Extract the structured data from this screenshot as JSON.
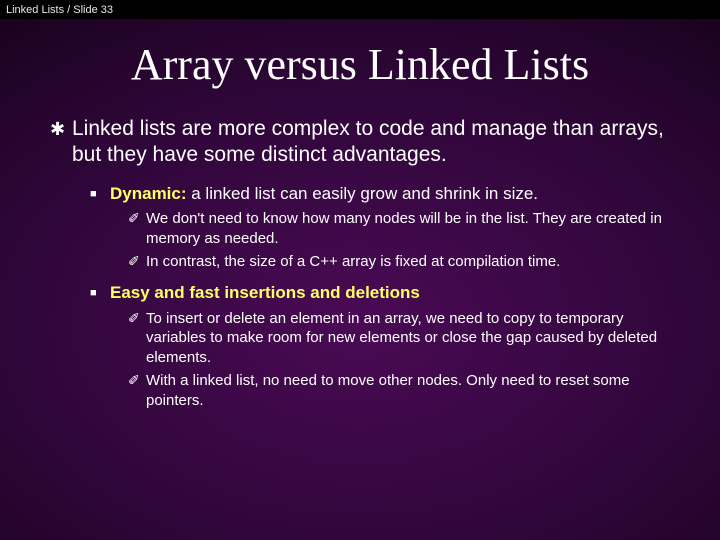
{
  "breadcrumb": "Linked Lists / Slide 33",
  "title": "Array versus Linked Lists",
  "l1": {
    "bullet": "✱",
    "text": "Linked lists are more complex to code and manage than arrays, but they have some distinct advantages."
  },
  "l2a": {
    "bullet": "■",
    "label": "Dynamic:",
    "rest": " a linked list can easily grow and shrink in size."
  },
  "l3a1": {
    "bullet": "✐",
    "text": "We don't need to know how many nodes will be in the list. They are created in memory as needed."
  },
  "l3a2": {
    "bullet": "✐",
    "text": "In contrast, the size of a C++ array is fixed at compilation time."
  },
  "l2b": {
    "bullet": "■",
    "label": "Easy and fast insertions and deletions",
    "rest": ""
  },
  "l3b1": {
    "bullet": "✐",
    "text": "To insert or delete an element in an array, we need to copy to temporary variables to make room for new elements or close the gap caused by deleted elements."
  },
  "l3b2": {
    "bullet": "✐",
    "text": "With a linked list, no need to move other nodes. Only need to reset some pointers."
  }
}
